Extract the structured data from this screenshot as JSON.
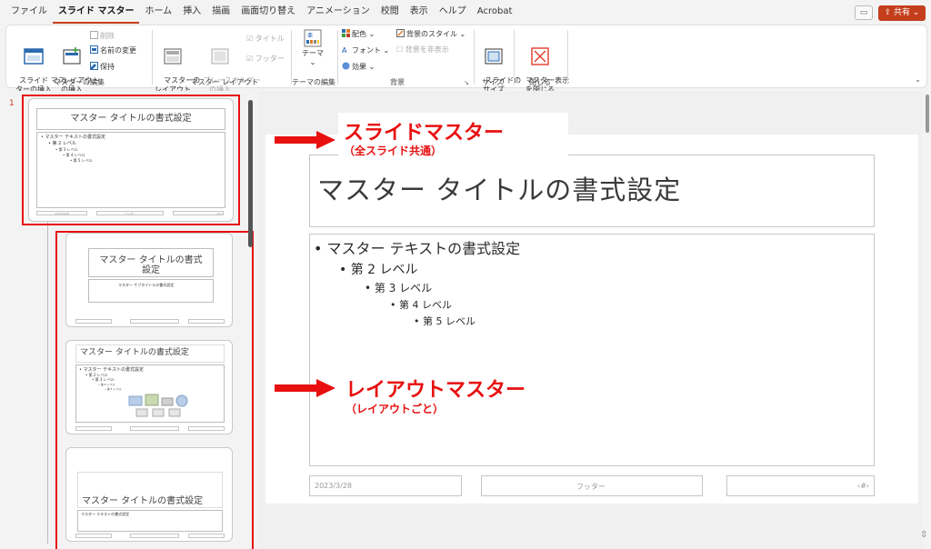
{
  "menu": [
    "ファイル",
    "スライド マスター",
    "ホーム",
    "挿入",
    "描画",
    "画面切り替え",
    "アニメーション",
    "校閲",
    "表示",
    "ヘルプ",
    "Acrobat"
  ],
  "share_label": "共有",
  "ribbon": {
    "insert_slide_master": "スライド マス\nターの挿入",
    "insert_layout": "レイアウト\nの挿入",
    "delete": "削除",
    "rename": "名前の変更",
    "preserve": "保持",
    "group_edit_master": "マスターの編集",
    "master_layout": "マスターの\nレイアウト",
    "insert_placeholder": "プレースホルダー\nの挿入",
    "title_check": "タイトル",
    "footer_check": "フッター",
    "group_master_layout": "マスター レイアウト",
    "themes": "テーマ",
    "group_edit_theme": "テーマの編集",
    "colors": "配色",
    "fonts": "フォント",
    "effects": "効果",
    "bg_styles": "背景のスタイル",
    "hide_bg": "背景を非表示",
    "group_background": "背景",
    "slide_size": "スライドの\nサイズ",
    "group_size": "サイズ",
    "close_master_view": "マスター表示\nを閉じる",
    "group_close": "閉じる"
  },
  "thumbnails": {
    "slide_number": "1",
    "master": {
      "title": "マスター タイトルの書式設定",
      "levels": [
        "• マスター テキストの書式設定",
        "• 第 2 レベル",
        "• 第 3 レベル",
        "• 第 4 レベル",
        "• 第 5 レベル"
      ],
      "footer_date": "2023/3/28",
      "footer_center": "フッター",
      "footer_num": "<#>"
    },
    "layout1": {
      "title": "マスター タイトルの書式\n設定",
      "subtitle": "マスター サブタイトルの書式設定"
    },
    "layout2": {
      "title": "マスター タイトルの書式設定",
      "levels": [
        "• マスター テキストの書式設定",
        "• 第 2 レベル",
        "• 第 3 レベル",
        "• 第 4 レベル",
        "• 第 5 レベル"
      ]
    },
    "layout3": {
      "title": "マスター タイトルの書式設定",
      "sub": "マスター テキストの書式設定"
    }
  },
  "slide": {
    "title": "マスター タイトルの書式設定",
    "levels": [
      "• マスター テキストの書式設定",
      "• 第 2 レベル",
      "• 第 3 レベル",
      "• 第 4 レベル",
      "• 第 5 レベル"
    ],
    "footer_date": "2023/3/28",
    "footer_center": "フッター",
    "footer_num": "‹#›"
  },
  "callouts": {
    "master_main": "スライドマスター",
    "master_sub": "（全スライド共通）",
    "layout_main": "レイアウトマスター",
    "layout_sub": "（レイアウトごと）"
  },
  "colors": {
    "accent": "#c43e1c",
    "callout": "#e81010"
  },
  "icons": [
    "slide-master-icon",
    "layout-icon",
    "delete-icon",
    "rename-icon",
    "preserve-icon",
    "master-layout-icon",
    "placeholder-icon",
    "themes-icon",
    "colors-icon",
    "fonts-icon",
    "effects-icon",
    "bg-style-icon",
    "slide-size-icon",
    "close-master-icon"
  ]
}
